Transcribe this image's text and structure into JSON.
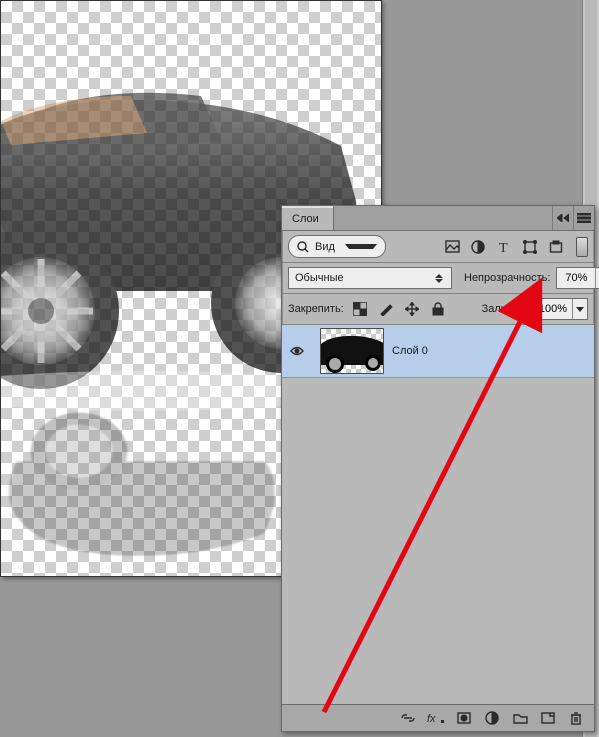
{
  "panel": {
    "title": "Слои",
    "filter_label": "Вид",
    "blend_mode": "Обычные",
    "opacity_label": "Непрозрачность:",
    "opacity_value": "70%",
    "lock_label": "Закрепить:",
    "fill_label": "Заливка:",
    "fill_value": "100%"
  },
  "layer": {
    "name": "Слой 0",
    "visible": true,
    "selected": true
  },
  "icons": {
    "search": "search-icon",
    "image_filter": "image-filon",
    "adjust_filter": "adjustments-icon",
    "text_filter": "type-icon",
    "shape_filter": "shape-icon",
    "smart_filter": "smart-object-icon",
    "lock_pixels": "checker-icon",
    "lock_brush": "brush-icon",
    "lock_move": "move-icon",
    "lock_all": "lock-icon",
    "link": "link-icon",
    "fx": "fx-icon",
    "mask": "mask-icon",
    "adjustment": "adjustment-layer-icon",
    "group": "folder-icon",
    "new": "new-layer-icon",
    "trash": "trash-icon"
  },
  "colors": {
    "arrow": "#e30613",
    "selection": "#b7ceea"
  }
}
